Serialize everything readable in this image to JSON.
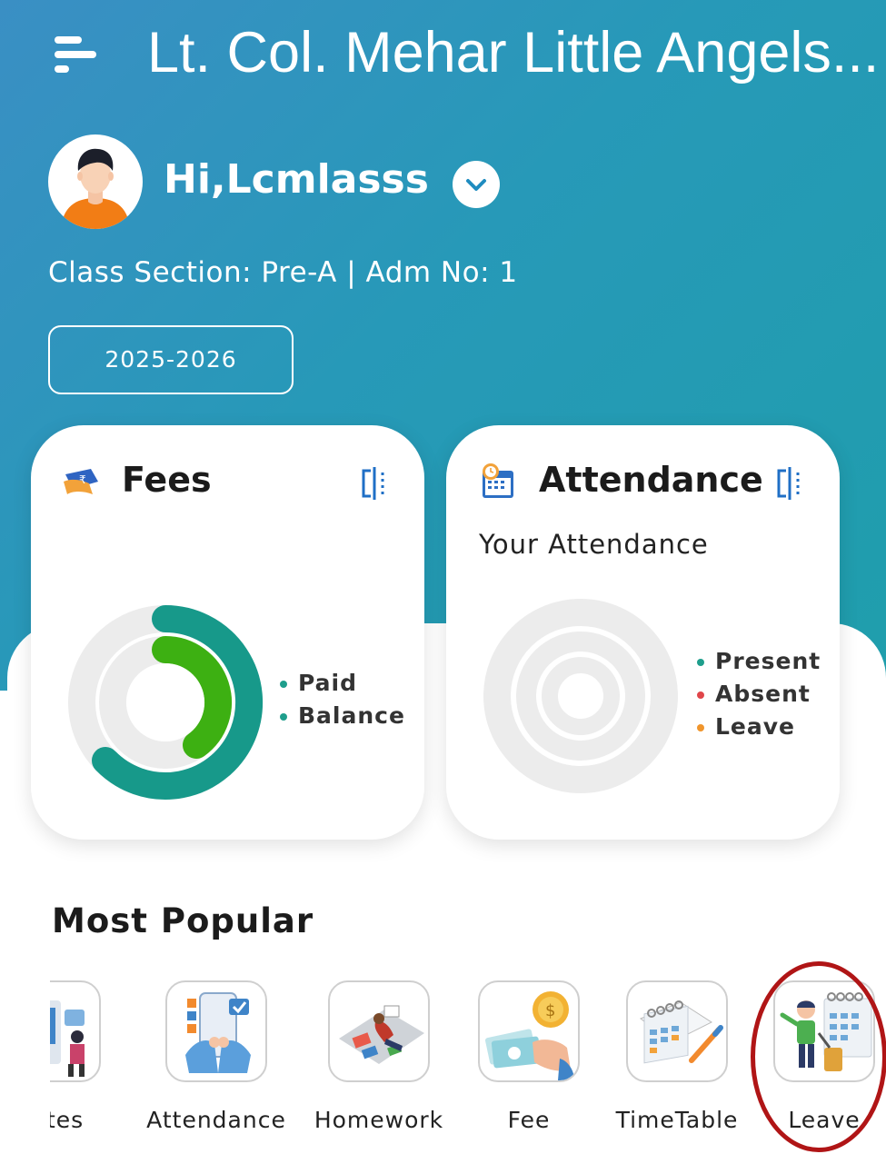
{
  "header": {
    "app_title": "Lt. Col. Mehar Little Angels...",
    "menu_icon": "hamburger-menu-icon"
  },
  "profile": {
    "greeting": "Hi,Lcmlasss",
    "class_info": "Class Section: Pre-A | Adm No: 1",
    "session": "2025-2026",
    "toggle_icon": "chevron-down-icon"
  },
  "fees_card": {
    "title": "Fees",
    "icon": "rupee-note-icon",
    "expand_icon": "expand-icon",
    "legend": [
      {
        "label": "Paid",
        "color": "#1e9e8c"
      },
      {
        "label": "Balance",
        "color": "#1e9e8c"
      }
    ],
    "chart_colors": {
      "outer": "#17998a",
      "inner": "#3db012",
      "track": "#ececec"
    }
  },
  "attendance_card": {
    "title": "Attendance",
    "icon": "calendar-clock-icon",
    "expand_icon": "expand-icon",
    "subtitle": "Your Attendance",
    "legend": [
      {
        "label": "Present",
        "color": "#1e9e8c"
      },
      {
        "label": "Absent",
        "color": "#e0464a"
      },
      {
        "label": "Leave",
        "color": "#f0952c"
      }
    ]
  },
  "colors": {
    "header_gradient_start": "#3a8fc4",
    "header_gradient_end": "#1f9eac",
    "highlight": "#b01516"
  },
  "most_popular": {
    "title": "Most Popular",
    "items": [
      {
        "label": "dates",
        "icon": "updates-icon"
      },
      {
        "label": "Attendance",
        "icon": "attendance-icon"
      },
      {
        "label": "Homework",
        "icon": "homework-icon"
      },
      {
        "label": "Fee",
        "icon": "fee-icon"
      },
      {
        "label": "TimeTable",
        "icon": "timetable-icon"
      },
      {
        "label": "Leave",
        "icon": "leave-icon"
      }
    ]
  }
}
